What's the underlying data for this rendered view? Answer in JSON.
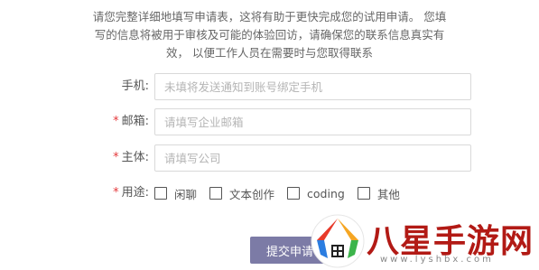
{
  "intro": {
    "line1": "请您完整详细地填写申请表，这将有助于更快完成您的试用申请。 您填",
    "line2": "写的信息将被用于审核及可能的体验回访，请确保您的联系信息真实有",
    "line3": "效， 以便工作人员在需要时与您取得联系"
  },
  "form": {
    "phone": {
      "label": "手机:",
      "required": false,
      "value": "",
      "placeholder": "未填将发送通知到账号绑定手机"
    },
    "email": {
      "label": "邮箱:",
      "required": true,
      "value": "",
      "placeholder": "请填写企业邮箱"
    },
    "company": {
      "label": "主体:",
      "required": true,
      "value": "",
      "placeholder": "请填写公司"
    },
    "purpose": {
      "label": "用途:",
      "required": true,
      "options": [
        {
          "label": "闲聊",
          "checked": false
        },
        {
          "label": "文本创作",
          "checked": false
        },
        {
          "label": "coding",
          "checked": false
        },
        {
          "label": "其他",
          "checked": false
        }
      ]
    },
    "required_mark": "*",
    "submit_label": "提交申请"
  },
  "watermark": {
    "text": "八星手游网",
    "url": "www.lyshbx.com",
    "brand_color": "#b21a15"
  },
  "colors": {
    "button": "#7c7ba6",
    "required": "#e4393c"
  }
}
